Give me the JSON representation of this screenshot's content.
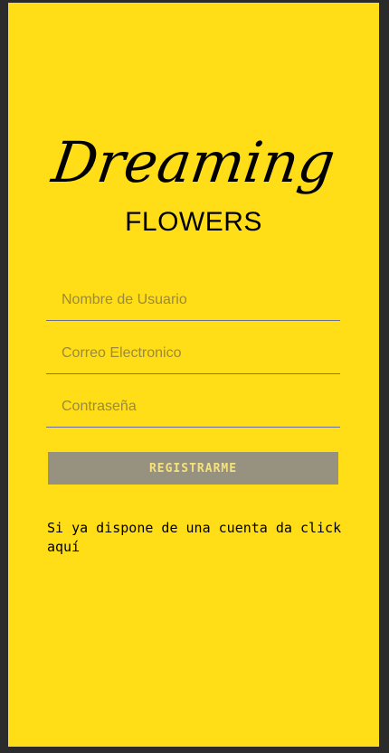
{
  "logo": {
    "script_text": "Dreaming",
    "sub_text": "FLOWERS"
  },
  "form": {
    "username_placeholder": "Nombre de Usuario",
    "email_placeholder": "Correo Electronico",
    "password_placeholder": "Contraseña",
    "submit_label": "REGISTRARME"
  },
  "footer": {
    "login_prompt": "Si ya dispone de una cuenta da click aquí"
  },
  "colors": {
    "background": "#ffde17",
    "button": "#96927f",
    "field_underline": "#6a6e9a"
  }
}
